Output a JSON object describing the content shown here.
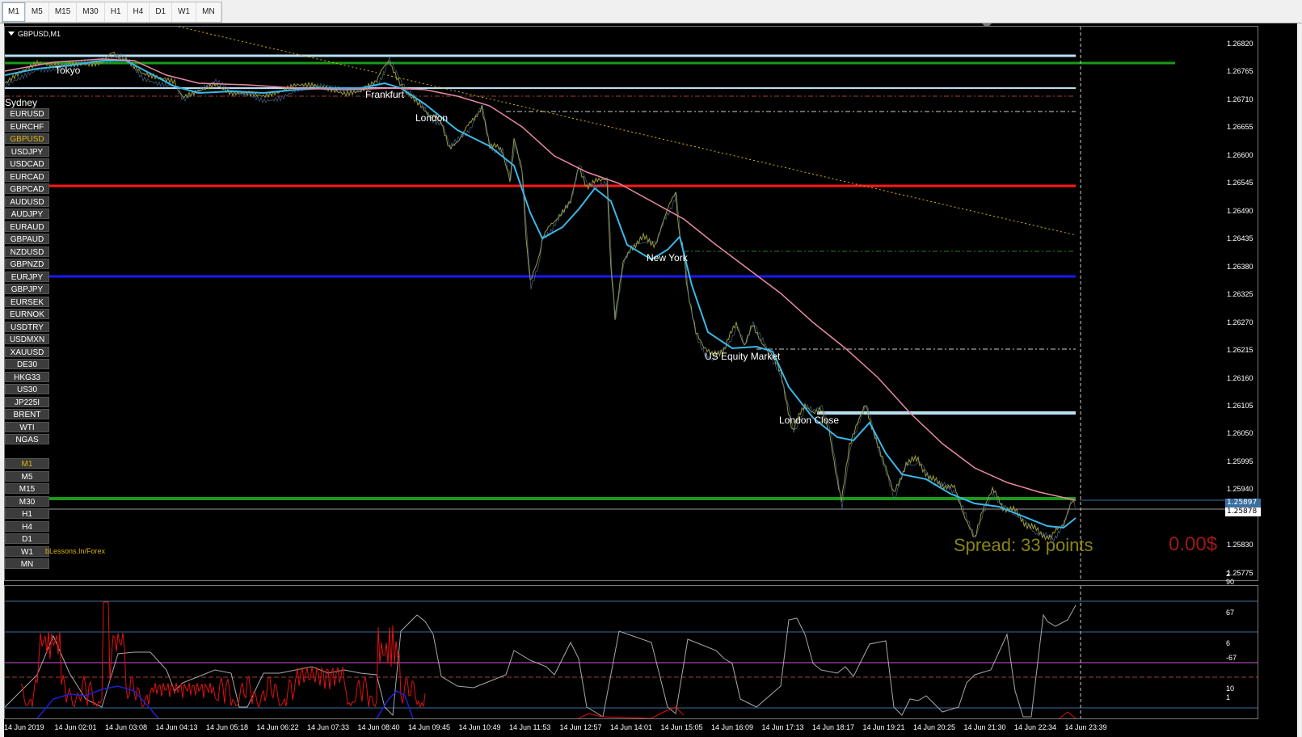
{
  "timeframe_bar": {
    "buttons": [
      "M1",
      "M5",
      "M15",
      "M30",
      "H1",
      "H4",
      "D1",
      "W1",
      "MN"
    ],
    "active": "M1"
  },
  "chart": {
    "symbol_label": "GBPUSD,M1",
    "symbols": [
      "EURUSD",
      "EURCHF",
      "GBPUSD",
      "USDJPY",
      "USDCAD",
      "EURCAD",
      "GBPCAD",
      "AUDUSD",
      "AUDJPY",
      "EURAUD",
      "GBPAUD",
      "NZDUSD",
      "GBPNZD",
      "EURJPY",
      "GBPJPY",
      "EURSEK",
      "EURNOK",
      "USDTRY",
      "USDMXN",
      "XAUUSD",
      "DE30",
      "HKG33",
      "US30",
      "JP225I",
      "BRENT",
      "WTI",
      "NGAS"
    ],
    "selected_symbol": "GBPUSD",
    "timeframes": [
      "M1",
      "M5",
      "M15",
      "M30",
      "H1",
      "H4",
      "D1",
      "W1",
      "MN"
    ],
    "selected_timeframe": "M1",
    "sessions": {
      "sydney": "Sydney",
      "tokyo": "Tokyo",
      "frankfurt": "Frankfurt",
      "london": "London",
      "new_york": "New York",
      "us_equity": "US Equity Market",
      "london_close": "London Close"
    },
    "watermark": "bLessons.In/Forex",
    "spread_text": "Spread: 33 points",
    "profit_text": "0.00$",
    "price_ticks": [
      "1.26820",
      "1.26765",
      "1.26710",
      "1.26655",
      "1.26600",
      "1.26545",
      "1.26490",
      "1.26435",
      "1.26380",
      "1.26325",
      "1.26270",
      "1.26215",
      "1.26160",
      "1.26105",
      "1.26050",
      "1.25995",
      "1.25940",
      "1.25830",
      "1.25775"
    ],
    "bid_label": "1.25897",
    "ask_label": "1.25878",
    "indicator_ticks": [
      "2",
      "90",
      "67",
      "6",
      "-67",
      "10",
      "1"
    ],
    "time_ticks": [
      "14 Jun 2019",
      "14 Jun 02:01",
      "14 Jun 03:08",
      "14 Jun 04:13",
      "14 Jun 05:18",
      "14 Jun 06:22",
      "14 Jun 07:33",
      "14 Jun 08:40",
      "14 Jun 09:45",
      "14 Jun 10:49",
      "14 Jun 11:53",
      "14 Jun 12:57",
      "14 Jun 14:01",
      "14 Jun 15:05",
      "14 Jun 16:09",
      "14 Jun 17:13",
      "14 Jun 18:17",
      "14 Jun 19:21",
      "14 Jun 20:25",
      "14 Jun 21:30",
      "14 Jun 22:34",
      "14 Jun 23:39"
    ],
    "price_range": [
      1.2577,
      1.2685
    ],
    "colors": {
      "price_line": "#9a9a3a",
      "ma_fast": "#3bb8e8",
      "ma_slow": "#e98aa3",
      "trend_dotted": "#d9b30a",
      "level_green": "#1a9a1a",
      "level_red": "#ff1a1a",
      "level_blue": "#1a1aff",
      "level_lightblue": "#b8dff0"
    }
  }
}
